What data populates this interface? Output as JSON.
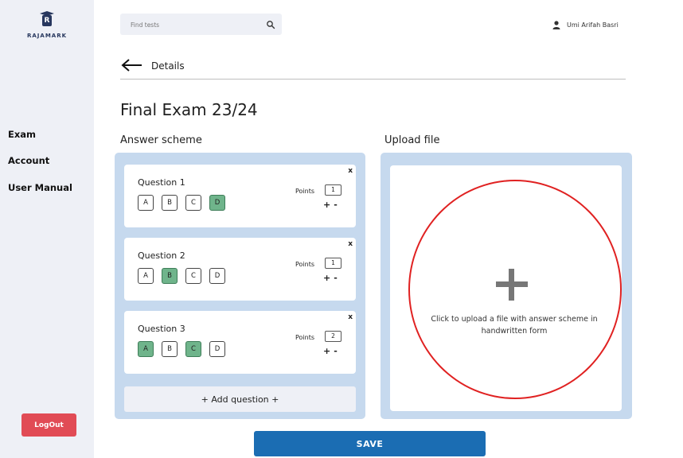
{
  "app": {
    "logo_text": "RAJAMARK",
    "logo_letter": "R"
  },
  "sidebar": {
    "items": [
      {
        "label": "Exam"
      },
      {
        "label": "Account"
      },
      {
        "label": "User Manual"
      }
    ],
    "logout_label": "LogOut"
  },
  "search": {
    "placeholder": "Find tests",
    "icon": "search-icon"
  },
  "user": {
    "name": "Umi Arifah Basri",
    "icon": "user-icon"
  },
  "header": {
    "back_icon": "arrow-left-icon",
    "breadcrumb": "Details"
  },
  "page": {
    "title": "Final Exam 23/24"
  },
  "answer_scheme": {
    "label": "Answer scheme",
    "points_label": "Points",
    "close_label": "x",
    "plus_label": "+",
    "minus_label": "-",
    "questions": [
      {
        "title": "Question 1",
        "options": [
          "A",
          "B",
          "C",
          "D"
        ],
        "selected": [
          "D"
        ],
        "points": "1"
      },
      {
        "title": "Question 2",
        "options": [
          "A",
          "B",
          "C",
          "D"
        ],
        "selected": [
          "B"
        ],
        "points": "1"
      },
      {
        "title": "Question 3",
        "options": [
          "A",
          "B",
          "C",
          "D"
        ],
        "selected": [
          "A",
          "C"
        ],
        "points": "2"
      }
    ],
    "add_label": "+ Add question +"
  },
  "upload": {
    "label": "Upload file",
    "text": "Click to upload a file with answer scheme in handwritten form",
    "icon": "plus-icon"
  },
  "save_label": "SAVE",
  "colors": {
    "sidebar_bg": "#eef0f6",
    "panel_bg": "#c6d9ee",
    "selected_option": "#6fb48b",
    "save_button": "#1b6db3",
    "logout_button": "#e14b55",
    "highlight_ring": "#e02121"
  }
}
